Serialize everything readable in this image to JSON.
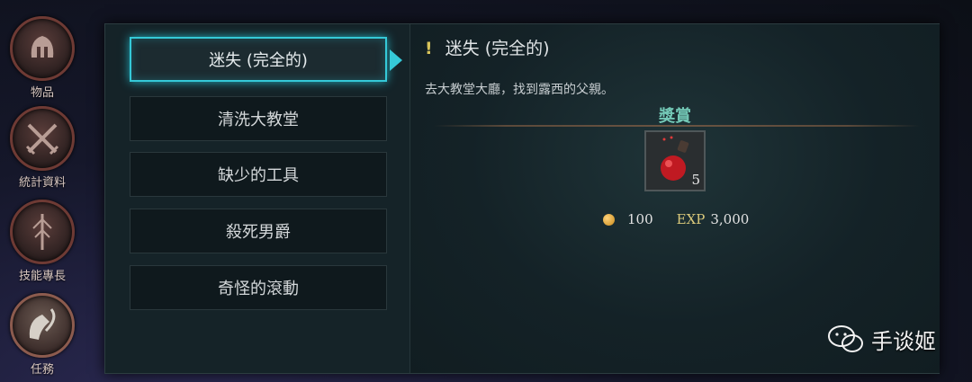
{
  "rail": {
    "items": [
      {
        "label": "物品",
        "icon": "helmet-icon"
      },
      {
        "label": "統計資料",
        "icon": "crossed-swords-icon"
      },
      {
        "label": "技能專長",
        "icon": "skill-emblem-icon"
      },
      {
        "label": "任務",
        "icon": "quill-scroll-icon",
        "active": true
      }
    ]
  },
  "quests": {
    "items": [
      {
        "label": "迷失 (完全的)",
        "active": true
      },
      {
        "label": "清洗大教堂"
      },
      {
        "label": "缺少的工具"
      },
      {
        "label": "殺死男爵"
      },
      {
        "label": "奇怪的滾動"
      }
    ]
  },
  "detail": {
    "marker": "!",
    "title": "迷失 (完全的)",
    "description": "去大教堂大廳，找到露西的父親。",
    "reward_heading": "獎賞",
    "reward_item": {
      "icon": "red-potion-icon",
      "count": "5"
    },
    "gold": "100",
    "exp_label": "EXP",
    "exp_value": "3,000"
  },
  "watermark": {
    "text": "手谈姬",
    "icon": "wechat-icon"
  },
  "colors": {
    "accent": "#35c9d8",
    "reward_heading": "#73c8b6",
    "exp": "#d9c87a",
    "marker": "#d8c45a"
  }
}
